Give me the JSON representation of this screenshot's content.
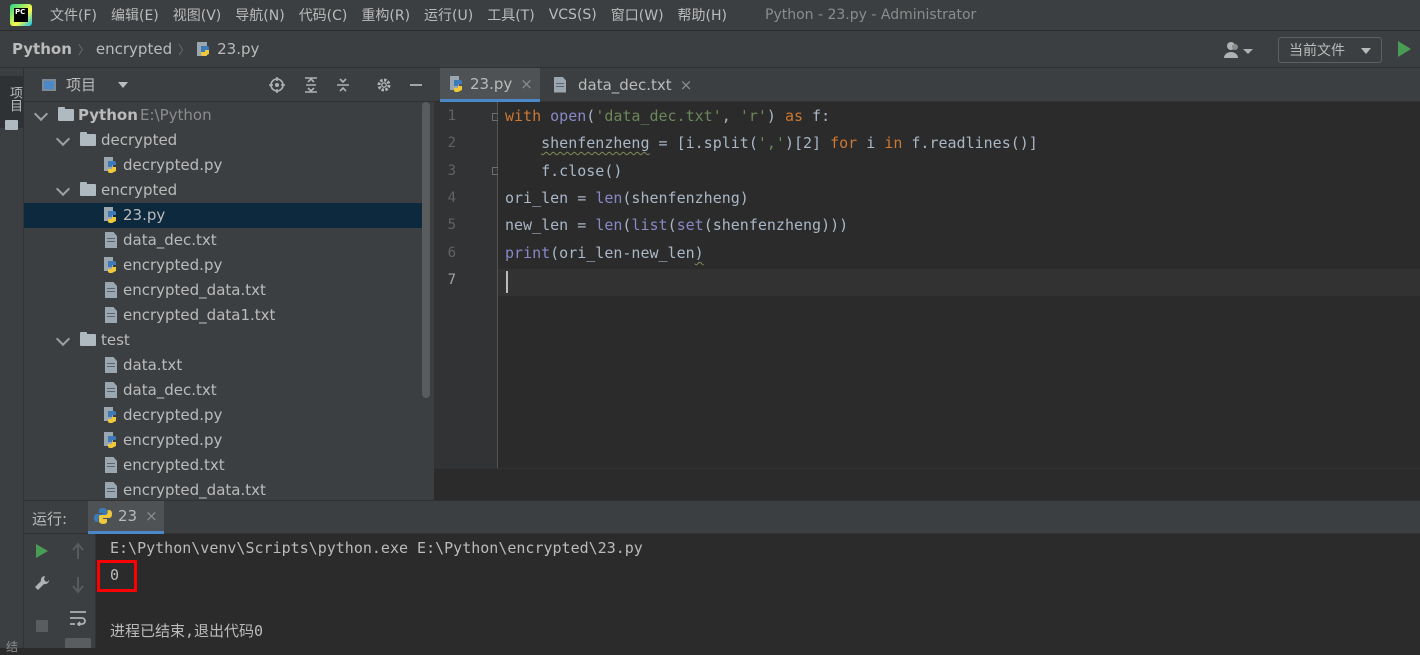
{
  "menubar": {
    "logo_text": "PC",
    "items": [
      "文件(F)",
      "编辑(E)",
      "视图(V)",
      "导航(N)",
      "代码(C)",
      "重构(R)",
      "运行(U)",
      "工具(T)",
      "VCS(S)",
      "窗口(W)",
      "帮助(H)"
    ],
    "window_title": "Python - 23.py - Administrator"
  },
  "navbar": {
    "crumbs": [
      "Python",
      "encrypted",
      "23.py"
    ],
    "run_config": "当前文件"
  },
  "left_stripe": {
    "project_label": "项目",
    "bottom_label": "结"
  },
  "project_panel": {
    "title": "项目",
    "tree": [
      {
        "label": "Python",
        "sub": "E:\\Python"
      },
      {
        "label": "decrypted"
      },
      {
        "label": "decrypted.py"
      },
      {
        "label": "encrypted"
      },
      {
        "label": "23.py"
      },
      {
        "label": "data_dec.txt"
      },
      {
        "label": "encrypted.py"
      },
      {
        "label": "encrypted_data.txt"
      },
      {
        "label": "encrypted_data1.txt"
      },
      {
        "label": "test"
      },
      {
        "label": "data.txt"
      },
      {
        "label": "data_dec.txt"
      },
      {
        "label": "decrypted.py"
      },
      {
        "label": "encrypted.py"
      },
      {
        "label": "encrypted.txt"
      },
      {
        "label": "encrypted_data.txt"
      }
    ]
  },
  "editor": {
    "tabs": [
      {
        "label": "23.py",
        "close": "×"
      },
      {
        "label": "data_dec.txt",
        "close": "×"
      }
    ],
    "line_numbers": [
      "1",
      "2",
      "3",
      "4",
      "5",
      "6",
      "7"
    ],
    "code": {
      "l1": {
        "a": "with",
        "b": " ",
        "c": "open",
        "d": "(",
        "e": "'data_dec.txt'",
        "f": ", ",
        "g": "'r'",
        "h": ") ",
        "i": "as",
        "j": " f:"
      },
      "l2": {
        "a": "    ",
        "b": "shenfenzheng",
        "c": " = [i.split(",
        "d": "','",
        "e": ")[2] ",
        "f": "for",
        "g": " i ",
        "h": "in",
        "i": " f.readlines()]"
      },
      "l3": {
        "a": "    f.close()"
      },
      "l4": {
        "a": "ori_len = ",
        "b": "len",
        "c": "(shenfenzheng)"
      },
      "l5": {
        "a": "new_len = ",
        "b": "len",
        "c": "(",
        "d": "list",
        "e": "(",
        "f": "set",
        "g": "(shenfenzheng)))"
      },
      "l6": {
        "a": "print",
        "b": "(ori_len-new_len",
        "c": ")"
      }
    }
  },
  "run_panel": {
    "label": "运行:",
    "tab_label": "23",
    "tab_close": "×",
    "console": [
      "E:\\Python\\venv\\Scripts\\python.exe E:\\Python\\encrypted\\23.py",
      "0",
      "",
      "进程已结束,退出代码0"
    ]
  },
  "colors": {
    "keyword": "#cc7832",
    "string": "#6a8759",
    "builtin": "#8888c6",
    "selection": "#0d293e",
    "highlight_box": "#ff0000",
    "run_green": "#499c54"
  }
}
